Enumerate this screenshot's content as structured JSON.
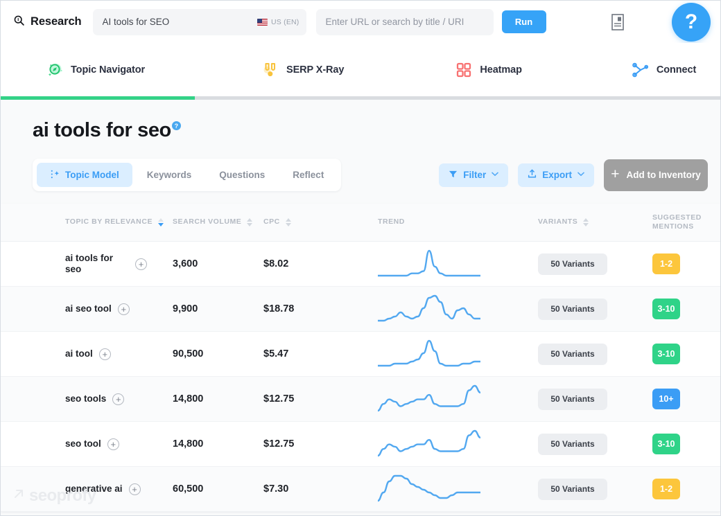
{
  "header": {
    "brand": "Research",
    "brand_icon": "search-icon",
    "keyword_value": "AI tools for SEO",
    "locale": "US (EN)",
    "locale_flag_icon": "us-flag-icon",
    "url_placeholder": "Enter URL or search by title / URI",
    "url_value": "",
    "run_label": "Run",
    "doc_icon": "document-icon",
    "help_label": "?",
    "accent_blue": "#36a3f7"
  },
  "nav": {
    "tabs": [
      {
        "label": "Topic Navigator",
        "icon": "compass-icon",
        "color": "#33d287",
        "active": true
      },
      {
        "label": "SERP X-Ray",
        "icon": "medal-icon",
        "color": "#fcc63c",
        "active": false
      },
      {
        "label": "Heatmap",
        "icon": "grid-icon",
        "color": "#f87171",
        "active": false
      },
      {
        "label": "Connect",
        "icon": "node-graph-icon",
        "color": "#3b9df5",
        "active": false
      }
    ],
    "progress_percent": 27,
    "progress_color": "#33d287"
  },
  "main": {
    "title": "ai tools for seo",
    "title_help": "?",
    "tabs": [
      {
        "label": "Topic Model",
        "icon": "sparkle-icon",
        "active": true
      },
      {
        "label": "Keywords",
        "active": false
      },
      {
        "label": "Questions",
        "active": false
      },
      {
        "label": "Reflect",
        "active": false
      }
    ],
    "filter_label": "Filter",
    "filter_icon": "funnel-icon",
    "export_label": "Export",
    "export_icon": "upload-icon",
    "chevron": "⌄",
    "add_label": "Add to Inventory",
    "add_plus": "+"
  },
  "table": {
    "columns": [
      {
        "label": "TOPIC BY RELEVANCE",
        "sortable": true,
        "sort_active": true,
        "sort_dir": "desc"
      },
      {
        "label": "SEARCH VOLUME",
        "sortable": true,
        "sort_active": false
      },
      {
        "label": "CPC",
        "sortable": true,
        "sort_active": false
      },
      {
        "label": "TREND",
        "sortable": false
      },
      {
        "label": "VARIANTS",
        "sortable": true,
        "sort_active": false
      },
      {
        "label": "SUGGESTED MENTIONS",
        "sortable": false
      }
    ],
    "rows": [
      {
        "topic": "ai tools for seo",
        "volume": "3,600",
        "cpc": "$8.02",
        "variants": "50 Variants",
        "mentions": "1-2",
        "mentions_color": "#fcc63c",
        "trend": [
          14,
          14,
          14,
          14,
          14,
          14,
          13,
          13,
          12,
          3,
          10,
          13,
          14,
          14,
          14,
          14,
          14,
          14,
          14
        ]
      },
      {
        "topic": "ai seo tool",
        "volume": "9,900",
        "cpc": "$18.78",
        "variants": "50 Variants",
        "mentions": "3-10",
        "mentions_color": "#2fd388",
        "trend": [
          15,
          15,
          14,
          13,
          11,
          13,
          14,
          13,
          9,
          4,
          3,
          6,
          12,
          14,
          10,
          9,
          12,
          14,
          14
        ]
      },
      {
        "topic": "ai tool",
        "volume": "90,500",
        "cpc": "$5.47",
        "variants": "50 Variants",
        "mentions": "3-10",
        "mentions_color": "#2fd388",
        "trend": [
          15,
          15,
          15,
          14,
          14,
          14,
          13,
          12,
          9,
          3,
          8,
          14,
          15,
          15,
          15,
          14,
          14,
          13,
          13
        ]
      },
      {
        "topic": "seo tools",
        "volume": "14,800",
        "cpc": "$12.75",
        "variants": "50 Variants",
        "mentions": "10+",
        "mentions_color": "#3b9df5",
        "trend": [
          14,
          11,
          9,
          10,
          12,
          11,
          10,
          9,
          9,
          7,
          11,
          12,
          12,
          12,
          12,
          11,
          5,
          3,
          6
        ]
      },
      {
        "topic": "seo tool",
        "volume": "14,800",
        "cpc": "$12.75",
        "variants": "50 Variants",
        "mentions": "3-10",
        "mentions_color": "#2fd388",
        "trend": [
          14,
          11,
          9,
          10,
          12,
          11,
          10,
          9,
          9,
          7,
          11,
          12,
          12,
          12,
          12,
          11,
          5,
          3,
          6
        ]
      },
      {
        "topic": "generative ai",
        "volume": "60,500",
        "cpc": "$7.30",
        "variants": "50 Variants",
        "mentions": "1-2",
        "mentions_color": "#fcc63c",
        "trend": [
          14,
          11,
          7,
          5,
          5,
          6,
          8,
          9,
          10,
          11,
          12,
          13,
          13,
          12,
          11,
          11,
          11,
          11,
          11
        ]
      }
    ]
  },
  "watermark": {
    "text": "seoprofy",
    "icon": "arrow-up-right-icon"
  }
}
